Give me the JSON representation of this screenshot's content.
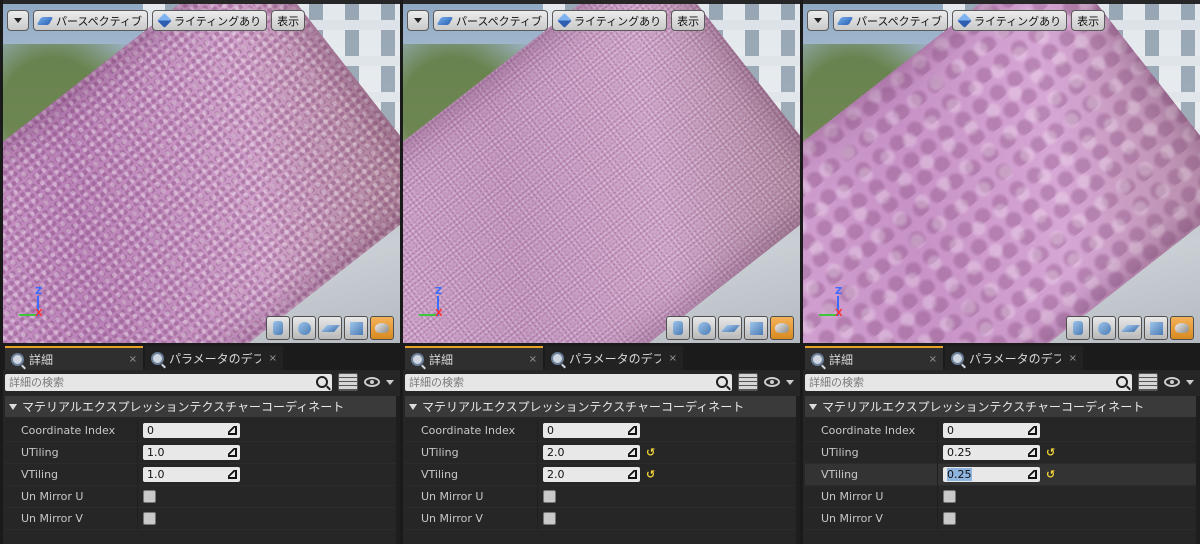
{
  "viewport": {
    "perspective_label": "パースペクティブ",
    "lighting_label": "ライティングあり",
    "show_label": "表示",
    "axis_z": "Z",
    "axis_x": "X"
  },
  "details": {
    "tab_details": "詳細",
    "tab_params": "パラメータのデフォルト",
    "tab_close": "×",
    "search_placeholder": "詳細の検索",
    "category_title": "マテリアルエクスプレッションテクスチャーコーディネート",
    "labels": {
      "coordinate_index": "Coordinate Index",
      "u_tiling": "UTiling",
      "v_tiling": "VTiling",
      "un_mirror_u": "Un Mirror U",
      "un_mirror_v": "Un Mirror V"
    },
    "reset_glyph": "↺"
  },
  "panes": [
    {
      "coordinate_index": "0",
      "u_tiling": "1.0",
      "v_tiling": "1.0",
      "un_mirror_u": false,
      "un_mirror_v": false
    },
    {
      "coordinate_index": "0",
      "u_tiling": "2.0",
      "v_tiling": "2.0",
      "un_mirror_u": false,
      "un_mirror_v": false
    },
    {
      "coordinate_index": "0",
      "u_tiling": "0.25",
      "v_tiling": "0.25",
      "un_mirror_u": false,
      "un_mirror_v": false
    }
  ],
  "colors": {
    "panel_bg": "#262626",
    "active_tab_accent": "#e8a22a",
    "reset_arrow": "#f1d23a",
    "selection_highlight": "#8eb4e0"
  }
}
